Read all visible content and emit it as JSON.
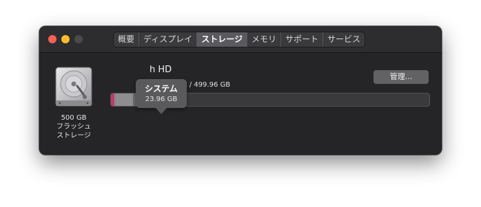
{
  "window": {
    "traffic_lights": [
      "close",
      "minimize",
      "zoom"
    ]
  },
  "tabs": [
    {
      "label": "概要",
      "active": false
    },
    {
      "label": "ディスプレイ",
      "active": false
    },
    {
      "label": "ストレージ",
      "active": true
    },
    {
      "label": "メモリ",
      "active": false
    },
    {
      "label": "サポート",
      "active": false
    },
    {
      "label": "サービス",
      "active": false
    }
  ],
  "disk": {
    "icon": "hard-drive-icon",
    "capacity": "500 GB",
    "type_line1": "フラッシュ",
    "type_line2": "ストレージ"
  },
  "drive": {
    "name": "h HD",
    "available_text": "GB利用可能 / 499.96 GB"
  },
  "manage_button": "管理...",
  "tooltip": {
    "title": "システム",
    "size": "23.96 GB"
  },
  "storage_bar": {
    "colors": {
      "apps": "#c0396b",
      "system": "#8e8e91",
      "other": "#6e6e71",
      "free": "#3a3a3d"
    }
  }
}
